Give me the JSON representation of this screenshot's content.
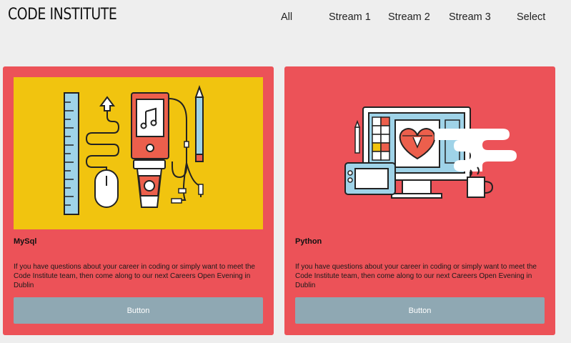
{
  "navbar": {
    "brand": "CODE INSTITUTE",
    "items": [
      "All",
      "Stream 1",
      "Stream 2",
      "Stream 3",
      "Select"
    ]
  },
  "cards": [
    {
      "title": "MySql",
      "text": "If you have questions about your career in coding or simply want to meet the Code Institute team, then come along to our next Careers Open Evening in Dublin",
      "button_label": "Button",
      "image_bg": "#f1c40f"
    },
    {
      "title": "Python",
      "text": "If you have questions about your career in coding or simply want to meet the Code Institute team, then come along to our next Careers Open Evening in Dublin",
      "button_label": "Button",
      "image_bg": "#ec5258"
    }
  ],
  "colors": {
    "page_bg": "#eeeeee",
    "card_bg": "#ec5258",
    "button_bg": "#8fa8b3",
    "image_yellow": "#f1c40f"
  }
}
